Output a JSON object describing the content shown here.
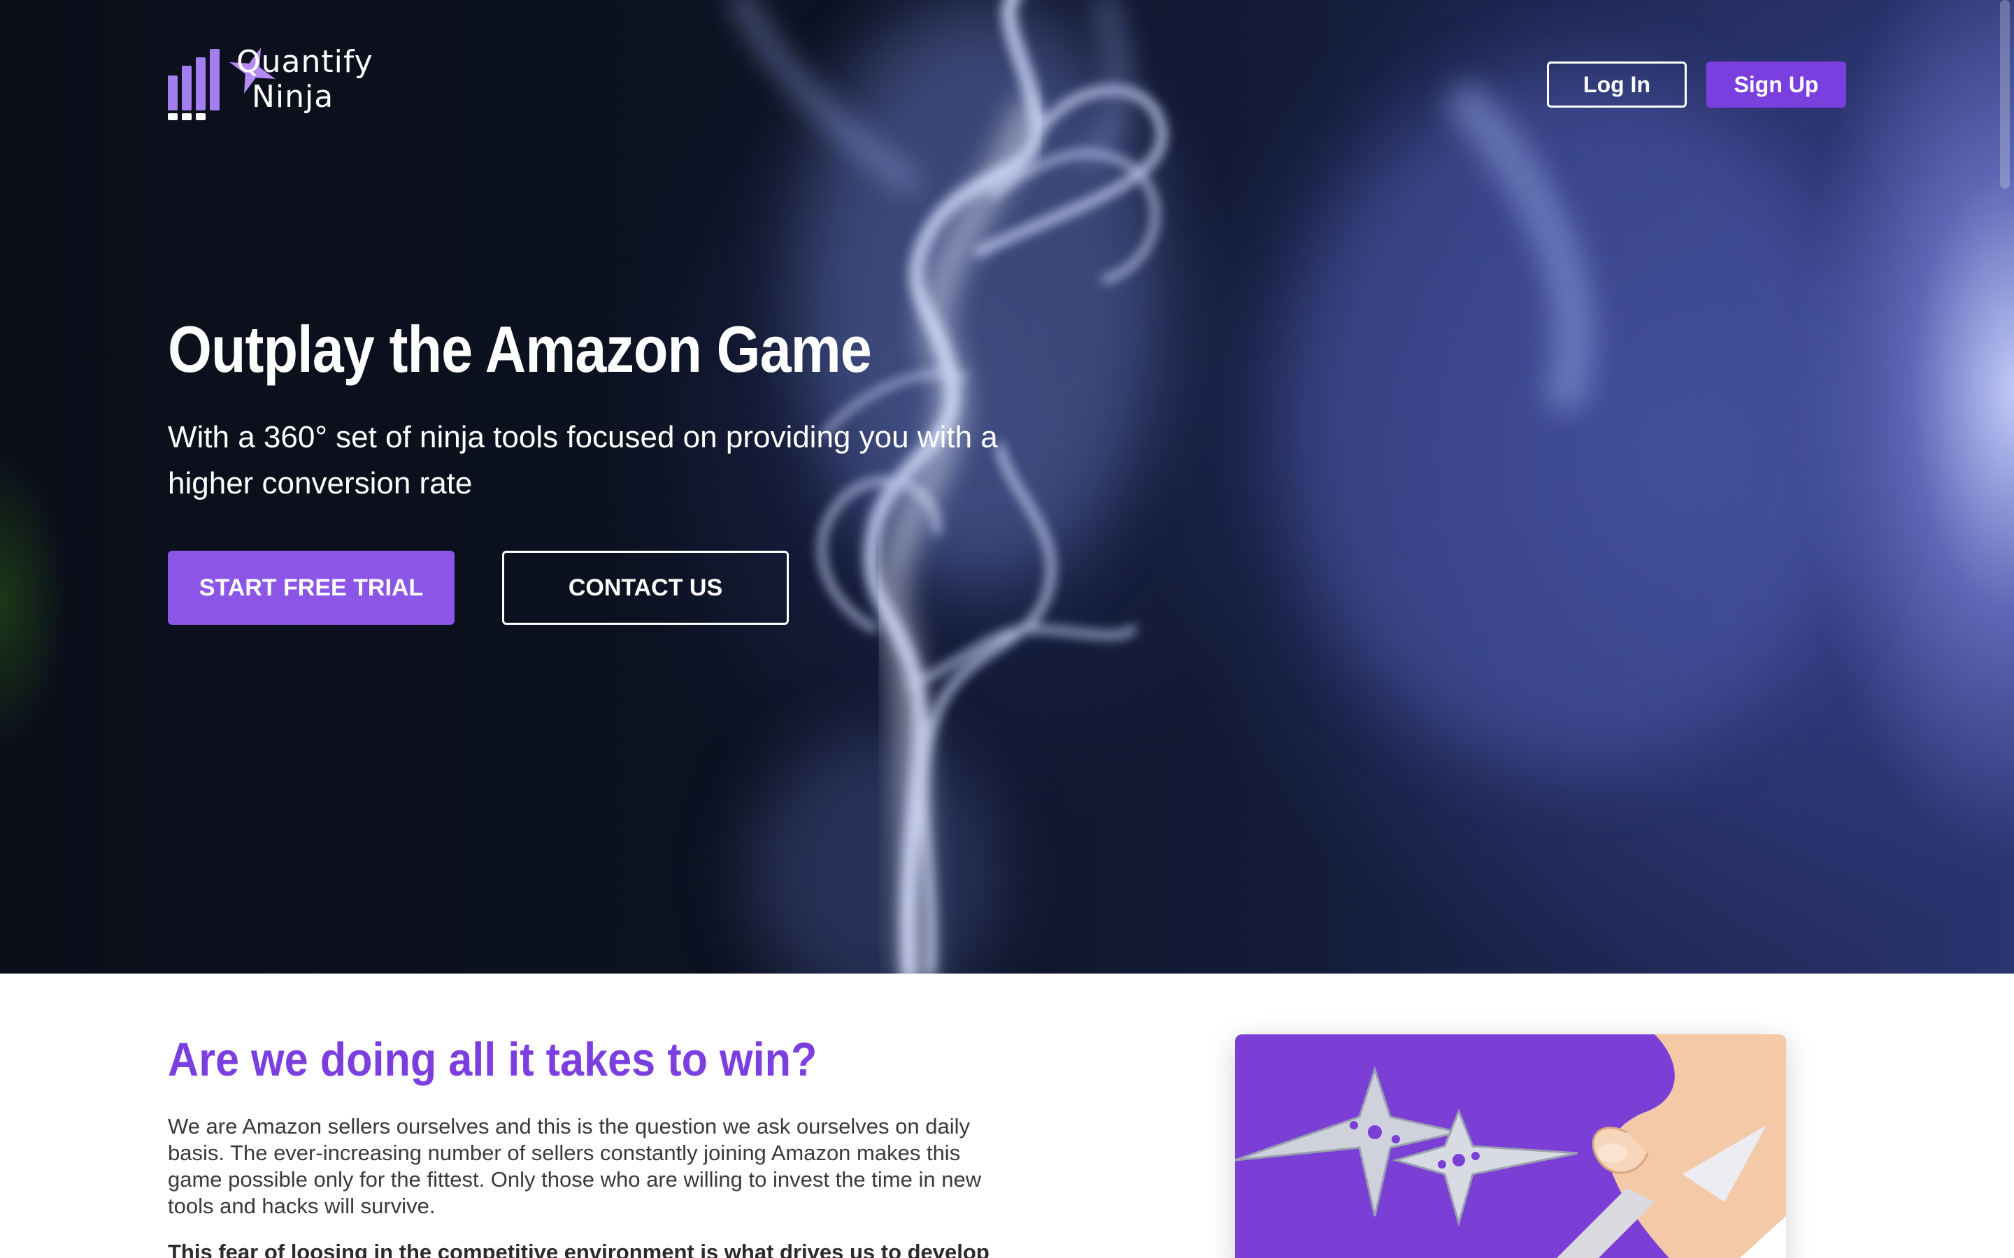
{
  "brand": {
    "name_line1": "Quantify",
    "name_line2": "Ninja",
    "accent_color": "#7b3fe0",
    "logo_icons": [
      "bar-chart-icon",
      "shuriken-icon"
    ]
  },
  "header": {
    "login_label": "Log In",
    "signup_label": "Sign Up"
  },
  "hero": {
    "title": "Outplay the Amazon Game",
    "subtitle": "With a 360° set of ninja tools focused on providing you with a higher conversion rate",
    "cta_primary": "START FREE TRIAL",
    "cta_secondary": "CONTACT US",
    "background": "smoke-video-background"
  },
  "intro": {
    "title": "Are we doing all it takes to win?",
    "paragraph1": "We are Amazon sellers ourselves and this is the question we ask ourselves on daily basis. The ever-increasing number of sellers constantly joining Amazon makes this game possible only for the fittest. Only those who are willing to invest the time in new tools and hacks will survive.",
    "paragraph2": "This fear of loosing in the competitive environment is what drives us to develop",
    "illustration": "shuriken-hand-illustration"
  }
}
